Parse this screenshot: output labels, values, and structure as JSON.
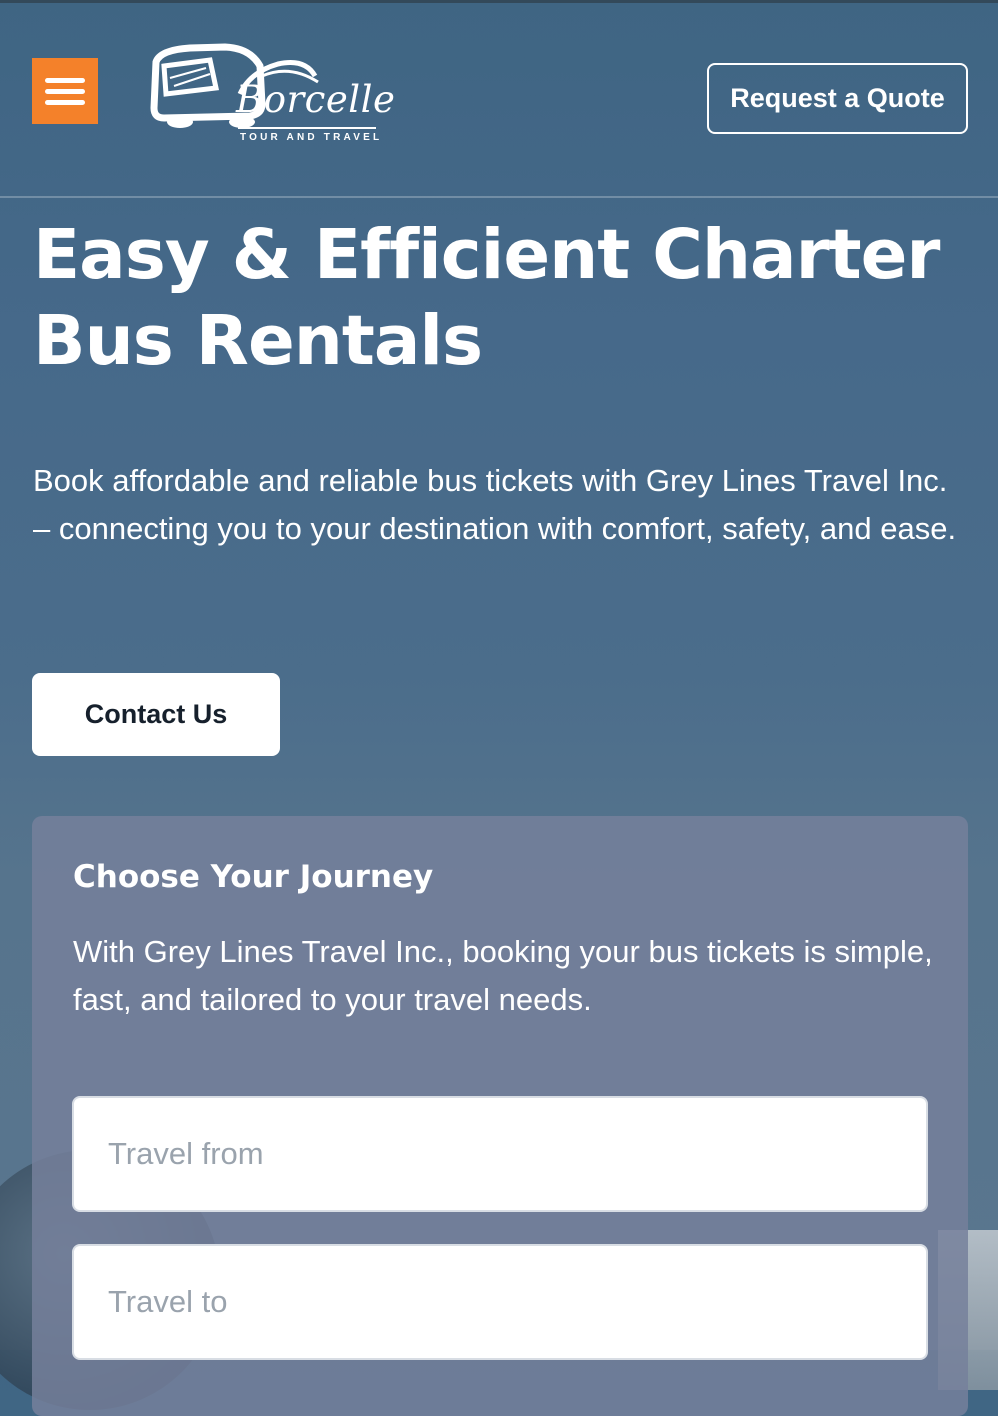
{
  "header": {
    "menu_icon": "hamburger-icon",
    "logo": {
      "wordmark": "Borcelle",
      "tagline": "TOUR AND TRAVEL",
      "icon": "bus-icon"
    },
    "quote_button": "Request a Quote"
  },
  "hero": {
    "title": "Easy & Efficient Charter Bus Rentals",
    "description": "Book affordable and reliable bus tickets with Grey Lines Travel Inc. – connecting you to your destination with comfort, safety, and ease.",
    "contact_button": "Contact Us"
  },
  "journey": {
    "heading": "Choose Your Journey",
    "description": "With Grey Lines Travel Inc., booking your bus tickets is simple, fast, and tailored to your travel needs.",
    "from_placeholder": "Travel from",
    "to_placeholder": "Travel to"
  },
  "colors": {
    "accent": "#f4812a",
    "background": "#46698a",
    "card": "#76809b"
  }
}
